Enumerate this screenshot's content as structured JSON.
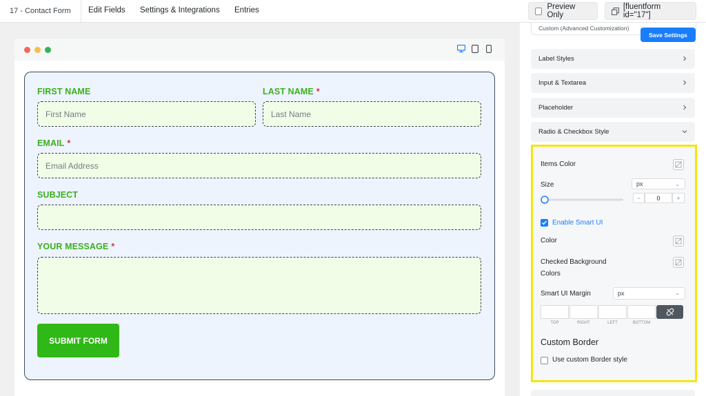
{
  "topbar": {
    "form_title": "17 - Contact Form",
    "nav": [
      "Edit Fields",
      "Settings & Integrations",
      "Entries"
    ],
    "preview_only": "Preview Only",
    "shortcode": "[fluentform id=\"17\"]"
  },
  "form": {
    "first_name_label": "FIRST NAME",
    "first_name_placeholder": "First Name",
    "last_name_label": "LAST NAME",
    "last_name_placeholder": "Last Name",
    "required_mark": "*",
    "email_label": "EMAIL",
    "email_placeholder": "Email Address",
    "subject_label": "SUBJECT",
    "message_label": "YOUR MESSAGE",
    "submit_label": "SUBMIT FORM"
  },
  "settings": {
    "custom_select": "Custom (Advanced Customization)",
    "save_button": "Save Settings",
    "accordions": [
      "Label Styles",
      "Input & Textarea",
      "Placeholder",
      "Radio & Checkbox Style"
    ],
    "items_color": "Items Color",
    "size": "Size",
    "size_unit": "px",
    "size_value": "0",
    "minus": "−",
    "plus": "+",
    "enable_smart_ui": "Enable Smart UI",
    "color": "Color",
    "checked_bg_line1": "Checked Background",
    "checked_bg_line2": "Colors",
    "smart_ui_margin": "Smart UI Margin",
    "margin_unit": "px",
    "margin_sides": [
      "TOP",
      "RIGHT",
      "LEFT",
      "BOTTOM"
    ],
    "custom_border": "Custom Border",
    "use_custom_border": "Use custom Border style"
  },
  "colors": {
    "accent": "#1a7efb",
    "label_green": "#3ab01e",
    "submit_green": "#30b818",
    "highlight": "#f5e60d"
  }
}
